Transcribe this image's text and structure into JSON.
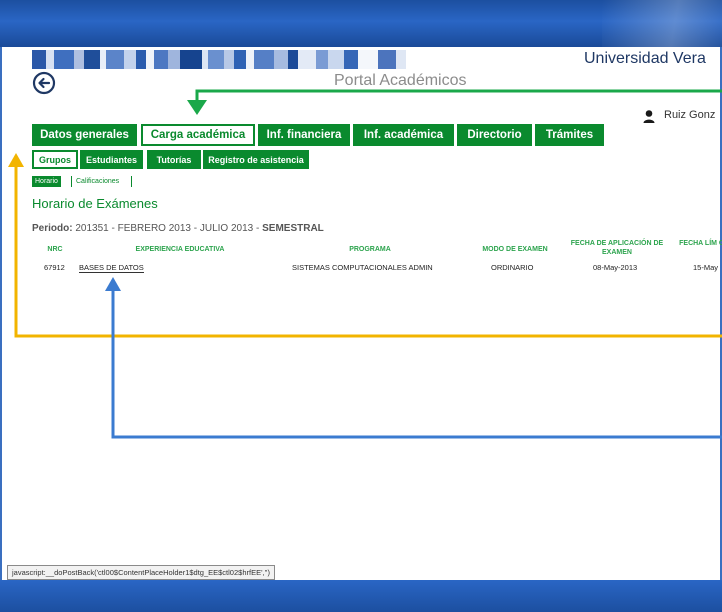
{
  "header": {
    "university_title": "Universidad Vera",
    "portal_title": "Portal Académicos",
    "user_name": "Ruiz Gonz"
  },
  "colors": {
    "accent_green": "#0a8a2e",
    "frame_blue": "#1c4fa0",
    "arrow_green": "#1aa84a",
    "arrow_yellow": "#f2b400",
    "arrow_blue": "#3b7bd0"
  },
  "icons": {
    "back": "back-arrow-icon",
    "user": "user-icon"
  },
  "nav": {
    "tabs": [
      {
        "label": "Datos generales",
        "active": false
      },
      {
        "label": "Carga académica",
        "active": true
      },
      {
        "label": "Inf. financiera",
        "active": false
      },
      {
        "label": "Inf. académica",
        "active": false
      },
      {
        "label": "Directorio",
        "active": false
      },
      {
        "label": "Trámites",
        "active": false
      }
    ],
    "subtabs": [
      {
        "label": "Grupos",
        "active": true
      },
      {
        "label": "Estudiantes",
        "active": false
      },
      {
        "label": "Tutorías",
        "active": false
      },
      {
        "label": "Registro de asistencia",
        "active": false
      }
    ],
    "subsubtabs": [
      {
        "label": "Horario",
        "active": true
      },
      {
        "label": "Calificaciones",
        "active": false
      }
    ]
  },
  "main": {
    "section_title": "Horario de Exámenes",
    "periodo_label": "Periodo:",
    "periodo_value": "201351 - FEBRERO 2013 - JULIO 2013 -",
    "periodo_type": "SEMESTRAL",
    "table": {
      "headers": [
        "NRC",
        "EXPERIENCIA EDUCATIVA",
        "PROGRAMA",
        "MODO DE EXAMEN",
        "FECHA DE APLICACIÓN DE EXAMEN",
        "FECHA LÍM CERRAR"
      ],
      "rows": [
        {
          "nrc": "67912",
          "ee": "BASES DE DATOS",
          "programa": "SISTEMAS COMPUTACIONALES ADMIN",
          "modo": "ORDINARIO",
          "fecha_aplicacion": "08-May-2013",
          "fecha_limite": "15-May"
        }
      ]
    }
  },
  "statusbar": {
    "text": "javascript:__doPostBack('ctl00$ContentPlaceHolder1$dtg_EE$ctl02$hrfEE','')"
  }
}
